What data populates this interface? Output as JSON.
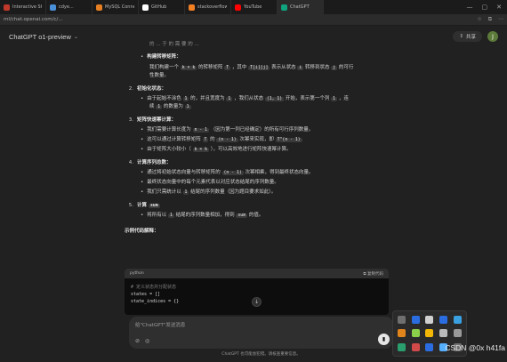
{
  "browser": {
    "tabs": [
      {
        "title": "Interactive Stack",
        "color": "#c0392b"
      },
      {
        "title": "cdye...",
        "color": "#4a90d9"
      },
      {
        "title": "MySQL Connector",
        "color": "#e67e22"
      },
      {
        "title": "GitHub",
        "color": "#ffffff"
      },
      {
        "title": "stackoverflow",
        "color": "#f48024"
      },
      {
        "title": "YouTube",
        "color": "#ff0000"
      },
      {
        "title": "ChatGPT",
        "color": "#10a37f"
      }
    ],
    "address": "ml/chat.openai.com/c/...",
    "window_controls": [
      "—",
      "▢",
      "✕"
    ]
  },
  "header": {
    "model": "ChatGPT o1-preview",
    "share_label": "共享",
    "avatar_letter": "J"
  },
  "answer": {
    "top_fragment": "的 ... 于 的 需 要 的 ...",
    "s1_bullet_title": "构建转移矩阵：",
    "s1_bullet_text1": "我们构建一个",
    "s1_code1": "k × k",
    "s1_bullet_text2": "的转移矩阵",
    "s1_code2": "T",
    "s1_bullet_text3": "，其中",
    "s1_code3": "T[i][j]",
    "s1_bullet_text4": "表示从状态",
    "s1_code4": "i",
    "s1_bullet_text5": "转移到状态",
    "s1_code5": "j",
    "s1_bullet_text6": "的可行",
    "s1_bullet_line2": "性数量。",
    "s2_num": "2.",
    "s2_title": "初始化状态：",
    "s2_bullet_a": "由于起始不涂色",
    "s2_code_a": "1",
    "s2_bullet_b": "的，并且宽度为",
    "s2_code_b": "1",
    "s2_bullet_c": "，我们从状态",
    "s2_code_c": "(1, 1)",
    "s2_bullet_d": "开始，表示第一个列",
    "s2_code_d": "1",
    "s2_bullet_e": "，连",
    "s2_line2_a": "续",
    "s2_line2_code": "1",
    "s2_line2_b": "的数量为",
    "s2_line2_code2": "1",
    "s3_num": "3.",
    "s3_title": "矩阵快速幂计算：",
    "s3_b1_a": "我们需要计算长度为",
    "s3_b1_code": "n - 1",
    "s3_b1_b": "（因为第一列已经确定）的所有可行序列数量。",
    "s3_b2_a": "这可以通过计算转移矩阵",
    "s3_b2_code": "T",
    "s3_b2_b": "的",
    "s3_b2_code2": "(n - 1)",
    "s3_b2_c": "次幂来实现，即",
    "s3_b2_code3": "T^(n - 1)",
    "s3_b3_a": "由于矩阵大小较小（",
    "s3_b3_code": "k × k",
    "s3_b3_b": "），可以高效地进行矩阵快速幂计算。",
    "s4_num": "4.",
    "s4_title": "计算序列总数：",
    "s4_b1_a": "通过将初始状态向量与转移矩阵的",
    "s4_b1_code": "(n - 1)",
    "s4_b1_b": "次幂相乘，得到最终状态向量。",
    "s4_b2": "最终状态向量中的每个元素代表以对应状态结尾的序列数量。",
    "s4_b3_a": "我们只需统计以",
    "s4_b3_code": "1",
    "s4_b3_b": "结尾的序列数量（因为题目要求如此）。",
    "s5_num": "5.",
    "s5_title": "计算",
    "s5_code": "sum",
    "s5_b1_a": "将所有以",
    "s5_b1_code": "1",
    "s5_b1_b": "结尾的序列数量相加，得到",
    "s5_b1_code2": "sum",
    "s5_b1_c": "的值。",
    "example_heading": "示例代码解释："
  },
  "codeblock": {
    "lang": "python",
    "copy_label": "复制代码",
    "lines": [
      "# 定义状态并分配状态",
      "states = []",
      "state_indices = {}"
    ]
  },
  "composer": {
    "placeholder": "给\"ChatGPT\"发送消息",
    "disclaimer": "ChatGPT 也可能会犯错。请核查重要信息。"
  },
  "tray": {
    "icons": [
      "#6f6f6f",
      "#2b6de0",
      "#d0d0d0",
      "#2b6de0",
      "#3aa0e0",
      "#e0841c",
      "#8bd04a",
      "#f2b705",
      "#bbbbbb",
      "#999999",
      "#2b9e6e",
      "#d04a4a",
      "#2b6de0",
      "#55b0ff",
      "#6f6f6f"
    ]
  },
  "watermark": "CSDN @0x h41fa"
}
